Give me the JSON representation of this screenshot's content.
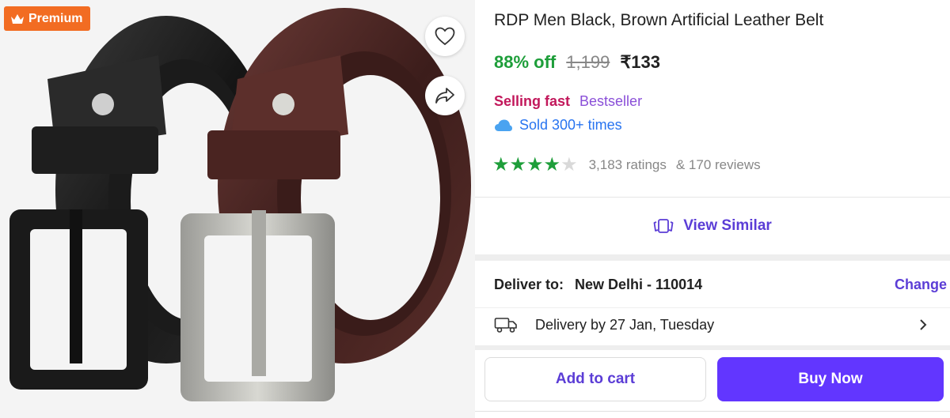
{
  "image": {
    "badge": "Premium",
    "icons": [
      "crown-icon",
      "heart-icon",
      "share-icon"
    ]
  },
  "product": {
    "title": "RDP Men Black, Brown Artificial Leather Belt",
    "discount": "88% off",
    "mrp": "1,199",
    "price": "₹133",
    "selling_fast": "Selling fast",
    "bestseller": "Bestseller",
    "sold": "Sold 300+ times",
    "rating_value": 4,
    "rating_max": 5,
    "ratings": "3,183 ratings",
    "reviews": "& 170 reviews"
  },
  "actions": {
    "view_similar": "View Similar",
    "add_to_cart": "Add to cart",
    "buy_now": "Buy Now"
  },
  "delivery": {
    "deliver_label": "Deliver to:",
    "location": "New Delhi - 110014",
    "change": "Change",
    "date_text": "Delivery by 27 Jan, Tuesday"
  },
  "colors": {
    "accent": "#5b3dd6",
    "buy_button": "#6236ff",
    "discount_green": "#1e9e3a",
    "premium_orange": "#f26c22",
    "selling_fast": "#c2185b"
  }
}
